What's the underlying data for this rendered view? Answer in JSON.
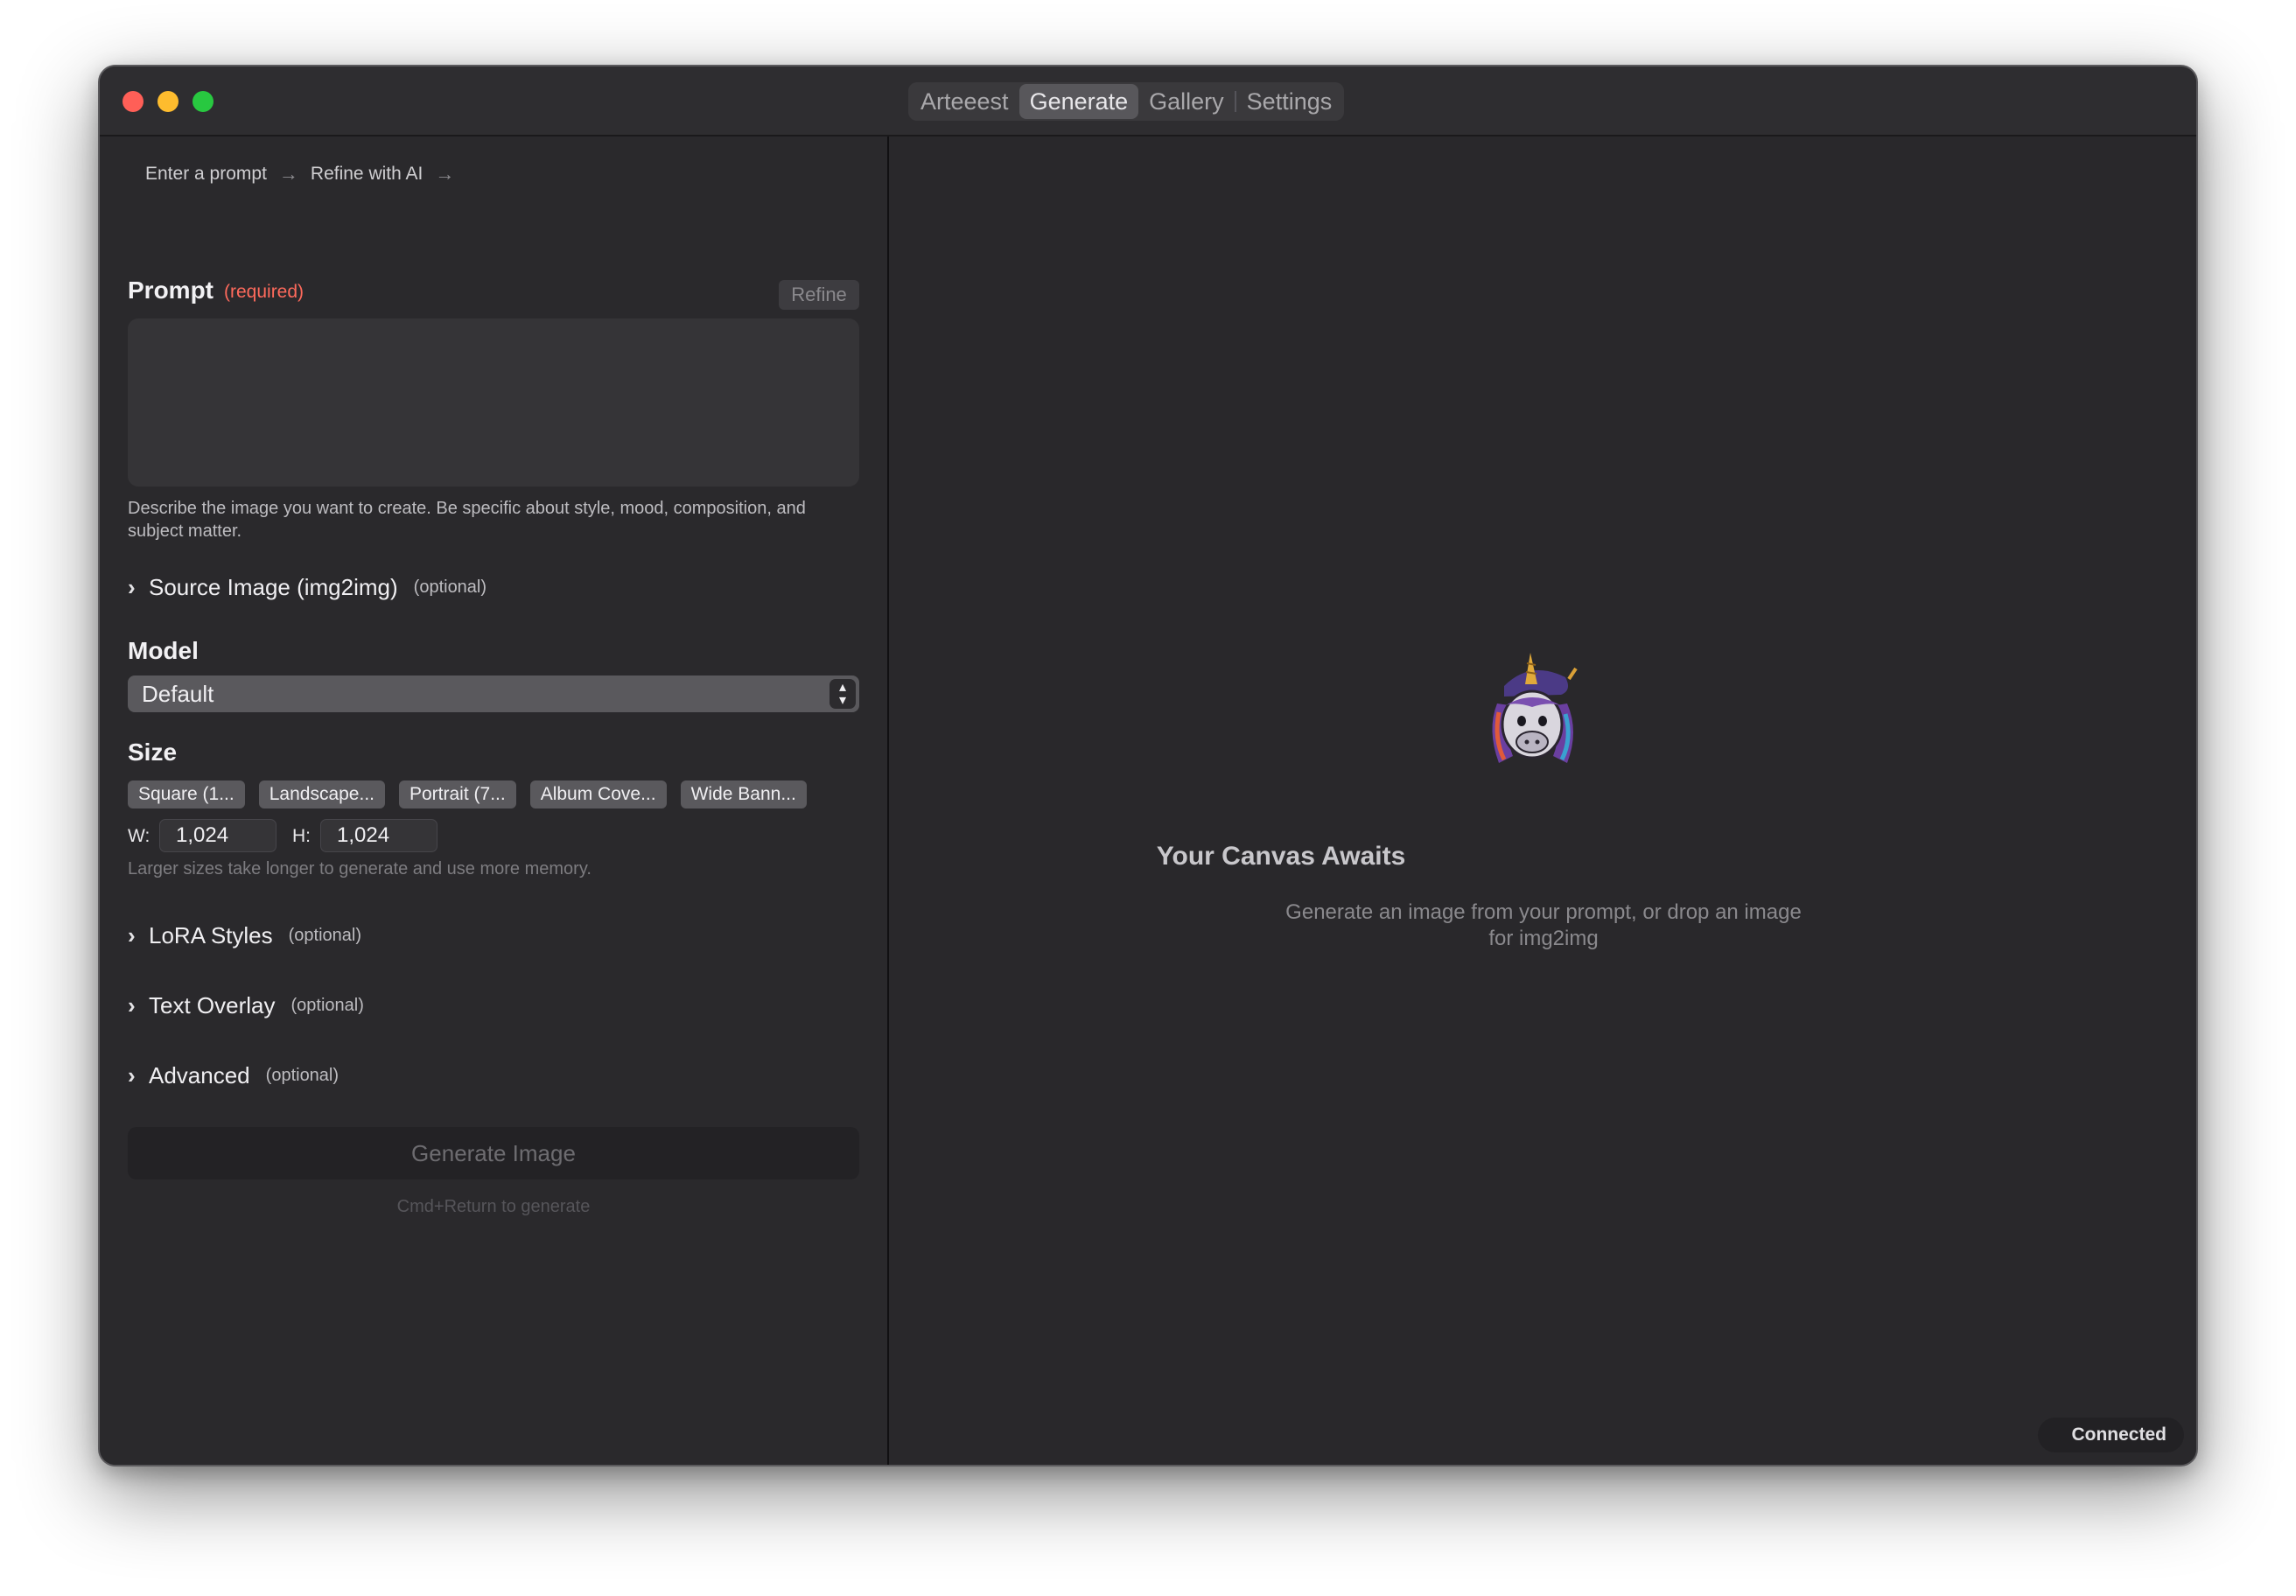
{
  "tabs": [
    {
      "label": "Arteeest"
    },
    {
      "label": "Generate",
      "active": true
    },
    {
      "label": "Gallery"
    },
    {
      "label": "Settings"
    }
  ],
  "breadcrumb": {
    "step1": "Enter a prompt",
    "step2": "Refine with AI",
    "arrow": "→"
  },
  "prompt": {
    "label": "Prompt",
    "required": "(required)",
    "refine_label": "Refine",
    "value": "",
    "help": "Describe the image you want to create. Be specific about style, mood, composition, and subject matter."
  },
  "source_image": {
    "label": "Source Image (img2img)",
    "optional": "(optional)"
  },
  "model": {
    "label": "Model",
    "selected": "Default"
  },
  "size": {
    "label": "Size",
    "presets": [
      "Square (1...",
      "Landscape...",
      "Portrait (7...",
      "Album Cove...",
      "Wide Bann..."
    ],
    "w_label": "W:",
    "h_label": "H:",
    "width": "1,024",
    "height": "1,024",
    "hint": "Larger sizes take longer to generate and use more memory."
  },
  "lora": {
    "label": "LoRA Styles",
    "optional": "(optional)"
  },
  "text_overlay": {
    "label": "Text Overlay",
    "optional": "(optional)"
  },
  "advanced": {
    "label": "Advanced",
    "optional": "(optional)"
  },
  "generate": {
    "label": "Generate Image",
    "hint": "Cmd+Return to generate"
  },
  "canvas": {
    "title": "Your Canvas Awaits",
    "subtitle": "Generate an image from your prompt, or drop an image for img2img"
  },
  "status": {
    "label": "Connected"
  },
  "colors": {
    "accent_required": "#ff6a5c",
    "window_bg": "#2a292c"
  }
}
